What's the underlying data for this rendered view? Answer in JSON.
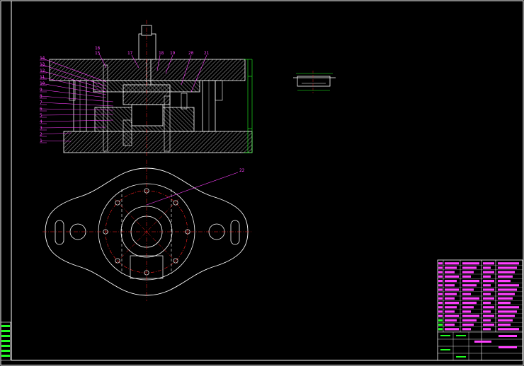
{
  "drawing": {
    "background": "#000000",
    "colors": {
      "outline": "#ffffff",
      "centerline": "#ff2020",
      "leader": "#ff40ff",
      "dimension": "#20ff20",
      "hatch": "#ffffff",
      "titleblock_fill": "#ff40ff"
    },
    "section_view": {
      "callouts_left": [
        "14",
        "13",
        "12",
        "11",
        "10",
        "9",
        "8",
        "7",
        "6",
        "5",
        "4",
        "3",
        "2",
        "1"
      ],
      "callouts_top": [
        "16",
        "15",
        "17",
        "18",
        "19",
        "20",
        "21"
      ]
    },
    "plan_view": {
      "callout": "22"
    }
  }
}
